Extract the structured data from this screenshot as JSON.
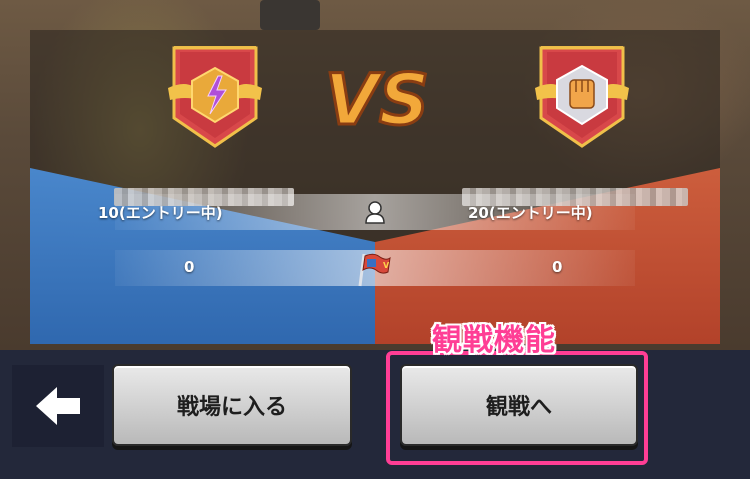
{
  "teams": {
    "left": {
      "entry_text": "10(エントリー中)",
      "score": "0",
      "color": "#3a78c2",
      "emblem_icon": "lightning-wings-emblem"
    },
    "right": {
      "entry_text": "20(エントリー中)",
      "score": "0",
      "color": "#c04a2e",
      "emblem_icon": "fist-wings-emblem"
    }
  },
  "vs_label": "VS",
  "icons": {
    "person": "person-icon",
    "flag": "flag-icon",
    "back": "back-arrow-icon"
  },
  "buttons": {
    "enter_battlefield": "戦場に入る",
    "spectate": "観戦へ"
  },
  "annotation": {
    "text": "観戦機能",
    "color": "#ff3e95"
  }
}
